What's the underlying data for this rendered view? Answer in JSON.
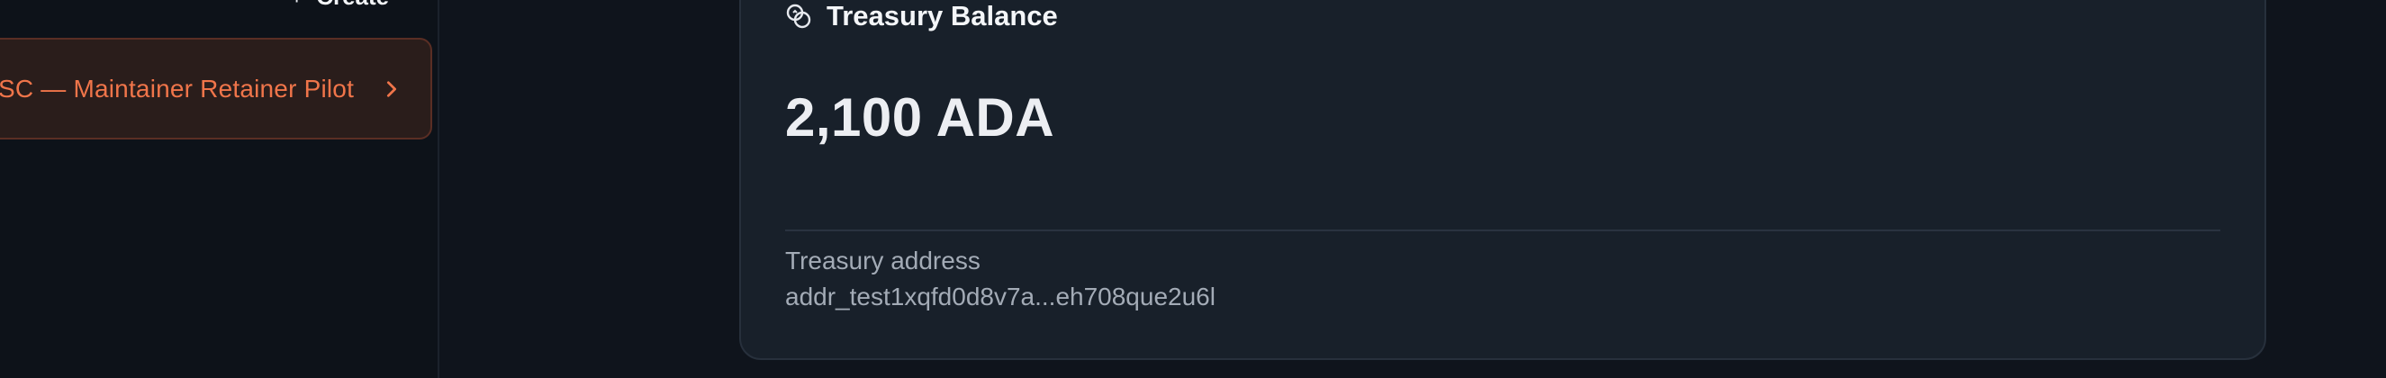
{
  "sidebar": {
    "top_action": {
      "icon": "plus-icon",
      "label": "Create"
    },
    "proposal_item": {
      "label": "SC — Maintainer Retainer Pilot",
      "icon": "chevron-right-icon",
      "accent_color": "#f0754a"
    }
  },
  "treasury_card": {
    "icon": "coins-icon",
    "title": "Treasury Balance",
    "balance": "2,100 ADA",
    "address_label": "Treasury address",
    "address_value": "addr_test1xqfd0d8v7a...eh708que2u6l"
  }
}
